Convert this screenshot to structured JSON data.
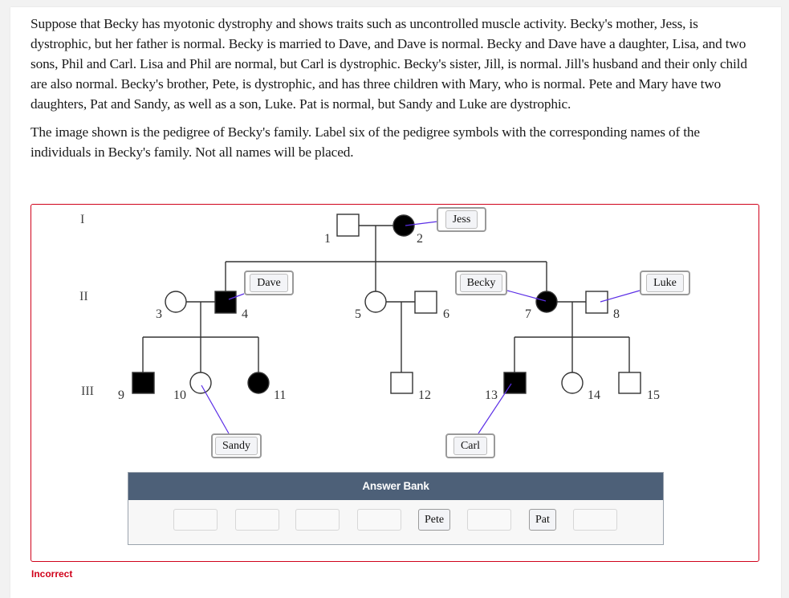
{
  "prompt": {
    "paragraph_1": "Suppose that Becky has myotonic dystrophy and shows traits such as uncontrolled muscle activity. Becky's mother, Jess, is dystrophic, but her father is normal. Becky is married to Dave, and Dave is normal. Becky and Dave have a daughter, Lisa, and two sons, Phil and Carl. Lisa and Phil are normal, but Carl is dystrophic. Becky's sister, Jill, is normal. Jill's husband and their only child are also normal. Becky's brother, Pete, is dystrophic, and has three children with Mary, who is normal. Pete and Mary have two daughters, Pat and Sandy, as well as a son, Luke. Pat is normal, but Sandy and Luke are dystrophic.",
    "paragraph_2": "The image shown is the pedigree of Becky's family. Label six of the pedigree symbols with the corresponding names of the individuals in Becky's family. Not all names will be placed."
  },
  "pedigree": {
    "generations": [
      "I",
      "II",
      "III"
    ],
    "individuals": [
      {
        "id": "1",
        "sex": "male",
        "affected": false
      },
      {
        "id": "2",
        "sex": "female",
        "affected": true
      },
      {
        "id": "3",
        "sex": "female",
        "affected": false
      },
      {
        "id": "4",
        "sex": "male",
        "affected": true
      },
      {
        "id": "5",
        "sex": "female",
        "affected": false
      },
      {
        "id": "6",
        "sex": "male",
        "affected": false
      },
      {
        "id": "7",
        "sex": "female",
        "affected": true
      },
      {
        "id": "8",
        "sex": "male",
        "affected": false
      },
      {
        "id": "9",
        "sex": "male",
        "affected": true
      },
      {
        "id": "10",
        "sex": "female",
        "affected": false
      },
      {
        "id": "11",
        "sex": "female",
        "affected": true
      },
      {
        "id": "12",
        "sex": "male",
        "affected": false
      },
      {
        "id": "13",
        "sex": "male",
        "affected": true
      },
      {
        "id": "14",
        "sex": "female",
        "affected": false
      },
      {
        "id": "15",
        "sex": "male",
        "affected": false
      }
    ],
    "placed_labels": [
      {
        "name": "Jess",
        "individual": "2"
      },
      {
        "name": "Dave",
        "individual": "4"
      },
      {
        "name": "Becky",
        "individual": "7"
      },
      {
        "name": "Luke",
        "individual": "8"
      },
      {
        "name": "Sandy",
        "individual": "10"
      },
      {
        "name": "Carl",
        "individual": "13"
      }
    ],
    "connector_color": "#5b2ee6",
    "affected_color": "#000000"
  },
  "answer_bank": {
    "title": "Answer Bank",
    "slots": [
      "",
      "",
      "",
      "",
      "Pete",
      "",
      "Pat",
      ""
    ]
  },
  "status": {
    "text": "Incorrect",
    "color": "#d0021b"
  }
}
